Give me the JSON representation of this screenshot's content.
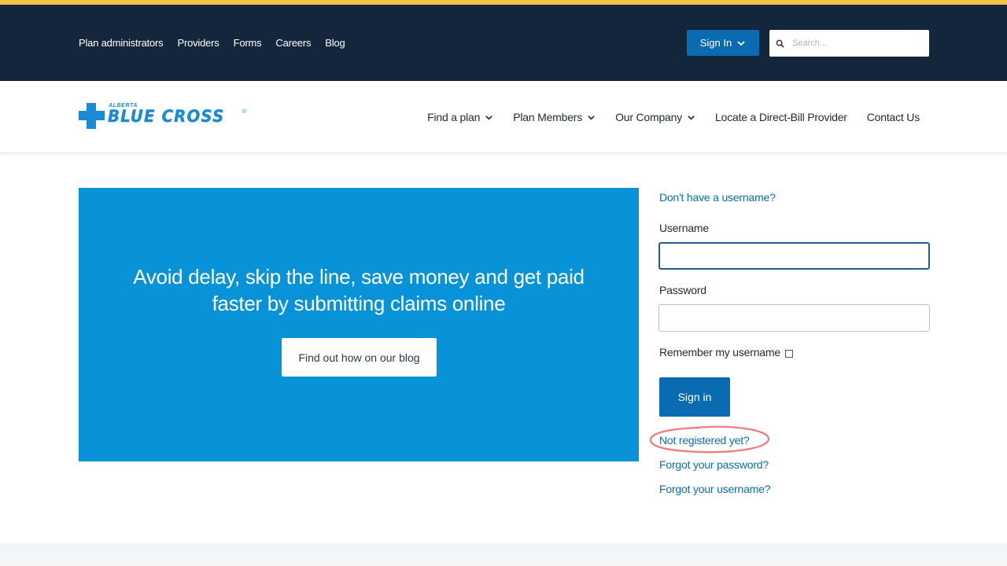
{
  "colors": {
    "accent_stripe": "#f2c14a",
    "topbar_bg": "#14263b",
    "primary_button": "#0b6bb0",
    "hero_bg": "#0893d9",
    "logo_blue": "#1a8ad4",
    "annotation_circle": "#f07a7a"
  },
  "topbar": {
    "links": [
      "Plan administrators",
      "Providers",
      "Forms",
      "Careers",
      "Blog"
    ],
    "signin_label": "Sign In",
    "search_placeholder": "Search..."
  },
  "logo": {
    "small_text": "ALBERTA",
    "main_text": "BLUE CROSS",
    "reg_mark": "®"
  },
  "nav": {
    "items": [
      {
        "label": "Find a plan",
        "icon": "chevron-down-icon"
      },
      {
        "label": "Plan Members",
        "icon": "chevron-down-icon"
      },
      {
        "label": "Our Company",
        "icon": "chevron-down-icon"
      },
      {
        "label": "Locate a Direct-Bill Provider",
        "icon": null
      },
      {
        "label": "Contact Us",
        "icon": null
      }
    ]
  },
  "hero": {
    "headline_line1": "Avoid delay, skip the line, save money and get paid",
    "headline_line2": "faster by submitting claims online",
    "button_label": "Find out how on our blog"
  },
  "login": {
    "no_username_link": "Don't have a username?",
    "username_label": "Username",
    "username_value": "",
    "password_label": "Password",
    "password_value": "",
    "remember_label": "Remember my username",
    "remember_checked": false,
    "signin_label": "Sign in",
    "not_registered_link": "Not registered yet?",
    "forgot_password_link": "Forgot your password?",
    "forgot_username_link": "Forgot your username?"
  }
}
